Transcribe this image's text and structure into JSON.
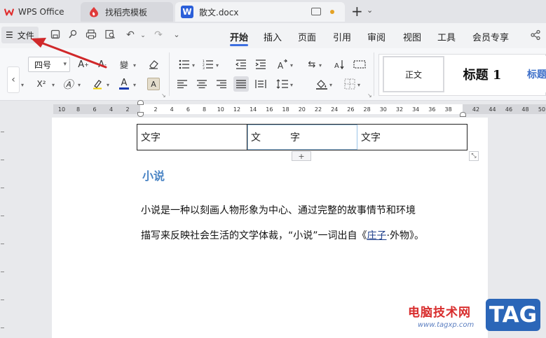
{
  "titlebar": {
    "tabs": [
      {
        "label": "WPS Office"
      },
      {
        "label": "找稻壳模板"
      },
      {
        "label": "散文.docx"
      }
    ]
  },
  "menubar": {
    "file_label": "文件",
    "items": [
      "开始",
      "插入",
      "页面",
      "引用",
      "审阅",
      "视图",
      "工具",
      "会员专享"
    ],
    "active": "开始"
  },
  "ribbon": {
    "font_size": "四号",
    "styles": {
      "normal": "正文",
      "heading1": "标题 1",
      "heading2": "标题"
    }
  },
  "ruler": {
    "ticks_left": [
      "10",
      "8",
      "6",
      "4",
      "2"
    ],
    "ticks_main": [
      "2",
      "4",
      "6",
      "8",
      "10",
      "12",
      "14",
      "16",
      "18",
      "20",
      "22",
      "24",
      "26",
      "28",
      "30",
      "32",
      "34",
      "36",
      "38"
    ],
    "ticks_right": [
      "42",
      "44",
      "46",
      "48",
      "50"
    ]
  },
  "document": {
    "table": {
      "cells": [
        "文字",
        "文",
        "字",
        "文字"
      ]
    },
    "table_add_label": "+",
    "heading": "小说",
    "paragraph_line1": "小说是一种以刻画人物形象为中心、通过完整的故事情节和环境",
    "paragraph_line2_before": "描写来反映社会生活的文学体裁，“小说”一词出自《",
    "paragraph_line2_link": "庄子",
    "paragraph_line2_after": "·外物》。"
  },
  "watermark": {
    "site_name": "电脑技术网",
    "url": "www.tagxp.com",
    "badge": "TAG"
  },
  "colors": {
    "accent": "#3d6fe0",
    "heading_blue": "#4a84c4",
    "annotation_arrow": "#d0282a"
  }
}
